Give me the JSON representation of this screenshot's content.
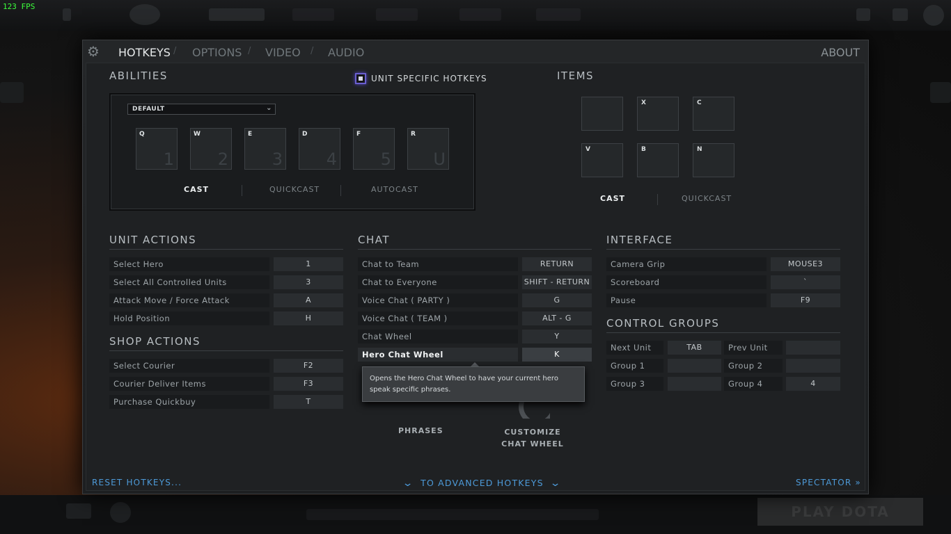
{
  "fps": "123 FPS",
  "tabs": {
    "hotkeys": "HOTKEYS",
    "options": "OPTIONS",
    "video": "VIDEO",
    "audio": "AUDIO",
    "separator": "/",
    "about": "ABOUT"
  },
  "abilities": {
    "title": "ABILITIES",
    "unit_specific_label": "UNIT SPECIFIC HOTKEYS",
    "unit_specific_checked": true,
    "dropdown_value": "DEFAULT",
    "slots": [
      {
        "key": "Q",
        "num": "1"
      },
      {
        "key": "W",
        "num": "2"
      },
      {
        "key": "E",
        "num": "3"
      },
      {
        "key": "D",
        "num": "4"
      },
      {
        "key": "F",
        "num": "5"
      },
      {
        "key": "R",
        "num": "U"
      }
    ],
    "modes": {
      "cast": "CAST",
      "quickcast": "QUICKCAST",
      "autocast": "AUTOCAST"
    }
  },
  "items": {
    "title": "ITEMS",
    "slots": [
      "",
      "X",
      "C",
      "V",
      "B",
      "N"
    ],
    "modes": {
      "cast": "CAST",
      "quickcast": "QUICKCAST"
    }
  },
  "unit_actions": {
    "title": "UNIT ACTIONS",
    "rows": [
      {
        "label": "Select Hero",
        "key": "1"
      },
      {
        "label": "Select All Controlled Units",
        "key": "3"
      },
      {
        "label": "Attack Move / Force Attack",
        "key": "A"
      },
      {
        "label": "Hold Position",
        "key": "H"
      }
    ]
  },
  "shop_actions": {
    "title": "SHOP ACTIONS",
    "rows": [
      {
        "label": "Select Courier",
        "key": "F2"
      },
      {
        "label": "Courier Deliver Items",
        "key": "F3"
      },
      {
        "label": "Purchase Quickbuy",
        "key": "T"
      }
    ]
  },
  "chat": {
    "title": "CHAT",
    "rows": [
      {
        "label": "Chat to Team",
        "key": "RETURN"
      },
      {
        "label": "Chat to Everyone",
        "key": "SHIFT - RETURN"
      },
      {
        "label": "Voice Chat ( PARTY )",
        "key": "G"
      },
      {
        "label": "Voice Chat ( TEAM )",
        "key": "ALT - G"
      },
      {
        "label": "Chat Wheel",
        "key": "Y"
      },
      {
        "label": "Hero Chat Wheel",
        "key": "K"
      }
    ],
    "tooltip": "Opens the Hero Chat Wheel to have your current hero speak specific phrases.",
    "phrases_label": "PHRASES",
    "customize_label": "CUSTOMIZE CHAT WHEEL"
  },
  "interface": {
    "title": "INTERFACE",
    "rows": [
      {
        "label": "Camera Grip",
        "key": "MOUSE3"
      },
      {
        "label": "Scoreboard",
        "key": "`"
      },
      {
        "label": "Pause",
        "key": "F9"
      }
    ]
  },
  "control_groups": {
    "title": "CONTROL GROUPS",
    "rows": [
      {
        "label": "Next Unit",
        "key": "TAB"
      },
      {
        "label": "Prev Unit",
        "key": ""
      },
      {
        "label": "Group 1",
        "key": ""
      },
      {
        "label": "Group 2",
        "key": ""
      },
      {
        "label": "Group 3",
        "key": ""
      },
      {
        "label": "Group 4",
        "key": "4"
      }
    ]
  },
  "footer": {
    "reset": "RESET HOTKEYS...",
    "advanced": "TO ADVANCED HOTKEYS",
    "spectator": "SPECTATOR »"
  },
  "play_button": "PLAY DOTA",
  "colors": {
    "accent_link": "#4d9ad8",
    "checkbox_glow": "#5546c8",
    "fps": "#3cff3c"
  }
}
